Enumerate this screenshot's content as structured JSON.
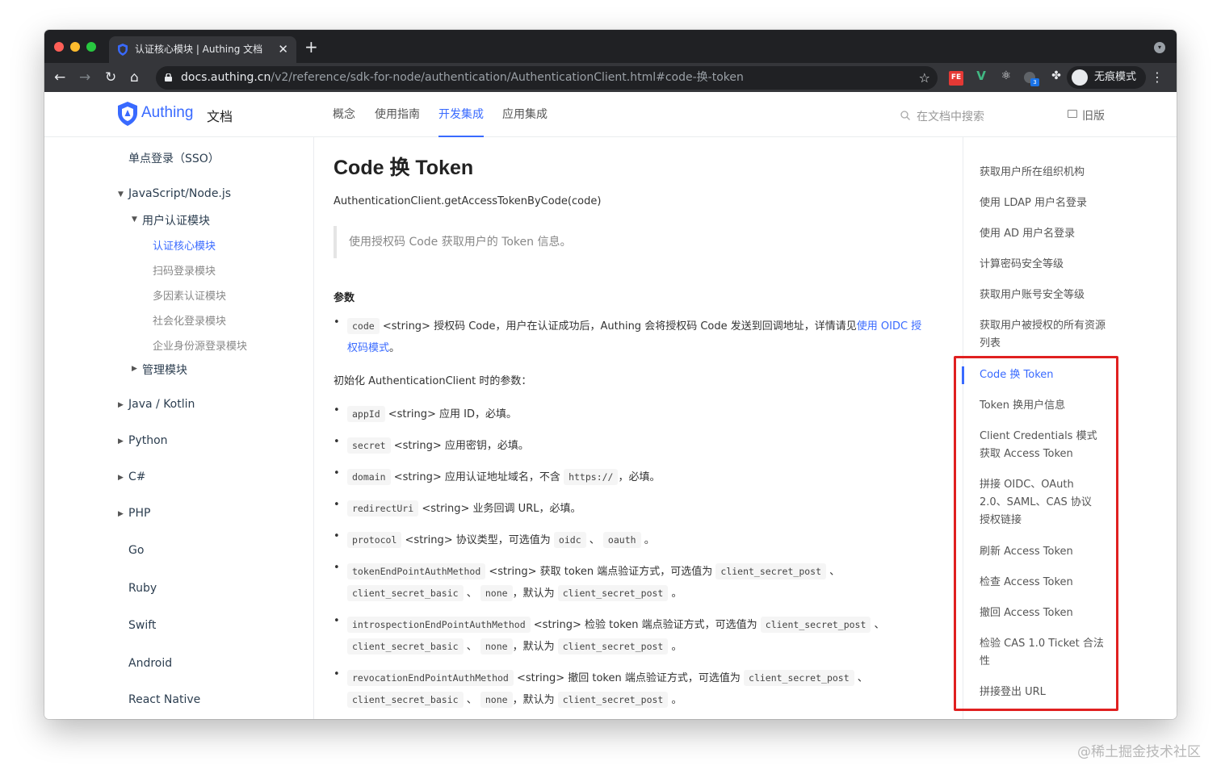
{
  "browser": {
    "tab_title": "认证核心模块 | Authing 文档",
    "tab_close": "✕",
    "new_tab": "+",
    "url_host": "docs.authing.cn",
    "url_path": "/v2/reference/sdk-for-node/authentication/AuthenticationClient.html#code-换-token",
    "incognito_label": "无痕模式",
    "ext_badge": "3"
  },
  "header": {
    "logo_text": "Authing",
    "logo_sub": "文档",
    "nav": [
      "概念",
      "使用指南",
      "开发集成",
      "应用集成"
    ],
    "search_placeholder": "在文档中搜索",
    "old_version": "旧版"
  },
  "sidebar": {
    "sso": "单点登录（SSO）",
    "js_node": "JavaScript/Node.js",
    "user_auth": "用户认证模块",
    "auth_core": "认证核心模块",
    "qr_login": "扫码登录模块",
    "mfa": "多因素认证模块",
    "social": "社会化登录模块",
    "enterprise": "企业身份源登录模块",
    "management": "管理模块",
    "java": "Java / Kotlin",
    "python": "Python",
    "csharp": "C#",
    "php": "PHP",
    "go": "Go",
    "ruby": "Ruby",
    "swift": "Swift",
    "android": "Android",
    "react_native": "React Native"
  },
  "content": {
    "title": "Code 换 Token",
    "signature": "AuthenticationClient.getAccessTokenByCode(code)",
    "description": "使用授权码 Code 获取用户的 Token 信息。",
    "params_heading": "参数",
    "code_param": {
      "name": "code",
      "text": "<string> 授权码 Code，用户在认证成功后，Authing 会将授权码 Code 发送到回调地址，详情请见",
      "link1": "使用 OIDC 授",
      "link2": "权码模式",
      "end": "。"
    },
    "init_text": "初始化 AuthenticationClient 时的参数：",
    "appId": {
      "name": "appId",
      "text": "<string> 应用 ID，必填。"
    },
    "secret": {
      "name": "secret",
      "text": "<string> 应用密钥，必填。"
    },
    "domain": {
      "name": "domain",
      "text": "<string> 应用认证地址域名，不含",
      "code2": "https://",
      "end": "，必填。"
    },
    "redirect": {
      "name": "redirectUri",
      "text": "<string> 业务回调 URL，必填。"
    },
    "protocol": {
      "name": "protocol",
      "text": "<string> 协议类型，可选值为",
      "opt1": "oidc",
      "sep": "、",
      "opt2": "oauth",
      "end": "。"
    },
    "token_method": {
      "name": "tokenEndPointAuthMethod",
      "text": "<string> 获取 token 端点验证方式，可选值为"
    },
    "intro_method": {
      "name": "introspectionEndPointAuthMethod",
      "text": "<string> 检验 token 端点验证方式，可选值为"
    },
    "revoke_method": {
      "name": "revocationEndPointAuthMethod",
      "text": "<string> 撤回 token 端点验证方式，可选值为"
    },
    "opt_post": "client_secret_post",
    "opt_basic": "client_secret_basic",
    "opt_none": "none",
    "sep": "、",
    "comma_default": "，默认为",
    "end": "。"
  },
  "toc": [
    "获取用户所在组织机构",
    "使用 LDAP 用户名登录",
    "使用 AD 用户名登录",
    "计算密码安全等级",
    "获取用户账号安全等级",
    "获取用户被授权的所有资源列表",
    "Code 换 Token",
    "Token 换用户信息",
    "Client Credentials 模式获取 Access Token",
    "拼接 OIDC、OAuth 2.0、SAML、CAS 协议授权链接",
    "刷新 Access Token",
    "检查 Access Token",
    "撤回 Access Token",
    "检验 CAS 1.0 Ticket 合法性",
    "拼接登出 URL"
  ],
  "watermark": "@稀土掘金技术社区",
  "colors": {
    "accent": "#396aff",
    "highlight": "#e02020",
    "chrome_dark": "#202124"
  }
}
